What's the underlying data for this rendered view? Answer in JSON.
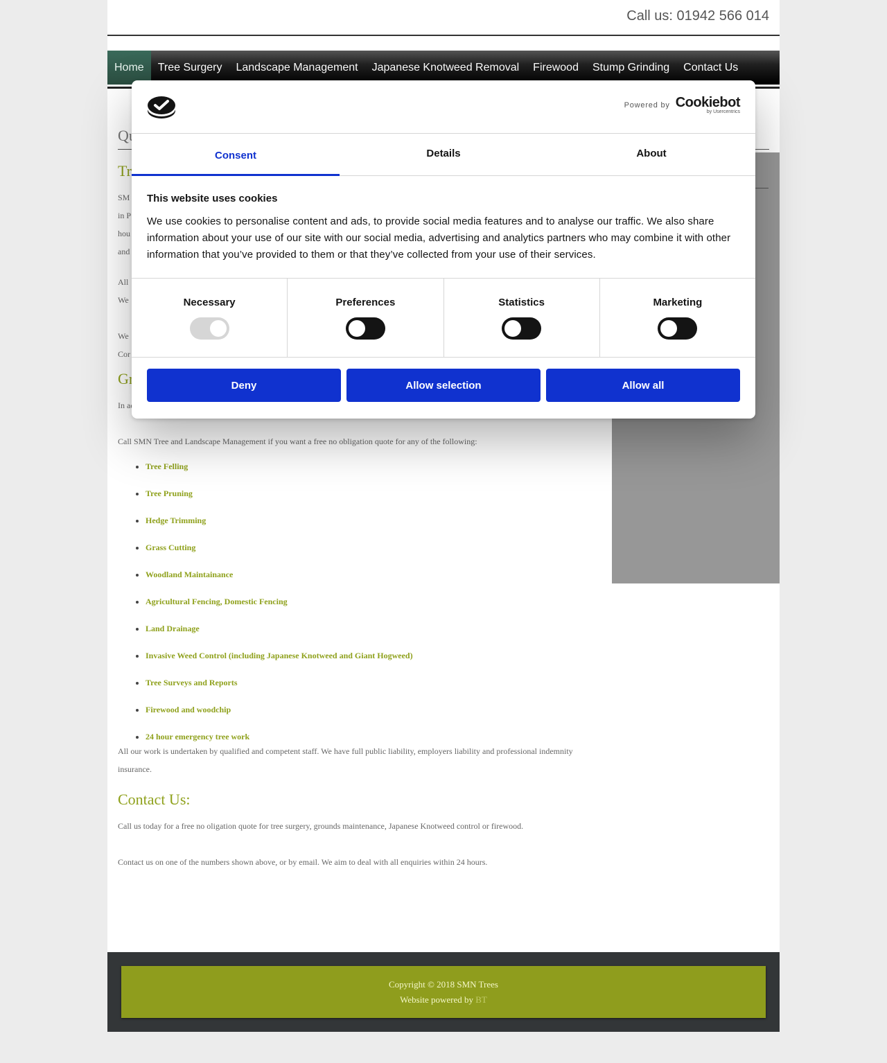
{
  "header": {
    "call_us": "Call us: 01942 566 014"
  },
  "nav": {
    "items": [
      {
        "label": "Home",
        "active": true
      },
      {
        "label": "Tree Surgery"
      },
      {
        "label": "Landscape Management"
      },
      {
        "label": "Japanese Knotweed Removal"
      },
      {
        "label": "Firewood"
      },
      {
        "label": "Stump Grinding"
      },
      {
        "label": "Contact Us"
      }
    ]
  },
  "content": {
    "page_heading_partial": "Qu",
    "section1_heading_partial": "Tr",
    "section1_lines_partial": [
      "SM",
      "in P",
      "hou",
      "and"
    ],
    "section1b_lines_partial": [
      "All",
      "We"
    ],
    "section1c_lines_partial": [
      "We",
      "Cor"
    ],
    "section2_heading_partial": "Gr",
    "para_grounds": "In addition to our arboricultural services we offer a range of bespoke grounds and landscape management services.",
    "para_call": "Call SMN Tree and Landscape Management if you want a free no obligation quote for any of the following:",
    "services": [
      "Tree Felling",
      "Tree Pruning",
      "Hedge Trimming",
      "Grass Cutting",
      "Woodland Maintainance",
      "Agricultural Fencing, Domestic Fencing",
      "Land Drainage",
      "Invasive Weed Control (including Japanese Knotweed and Giant Hogweed)",
      "Tree Surveys and Reports",
      "Firewood and woodchip",
      "24 hour emergency tree work"
    ],
    "para_staff": "All our work is undertaken by qualified and competent staff. We have full public liability, employers liability and professional indemnity insurance.",
    "contact_heading": "Contact Us:",
    "para_contact1": "Call us today for a free no oligation quote for tree surgery, grounds maintenance, Japanese Knotweed control or firewood.",
    "para_contact2": "Contact us on one of the numbers shown above, or by email. We aim to deal with all enquiries within 24 hours."
  },
  "footer": {
    "copyright": "Copyright © 2018 SMN Trees",
    "powered_prefix": "Website powered by",
    "powered_name": "BT"
  },
  "cookie_dialog": {
    "logo_icon": "cookiebot-check-logo-icon",
    "powered_by": "Powered by",
    "brand_name": "Cookiebot",
    "brand_sub": "by Usercentrics",
    "tabs": [
      {
        "label": "Consent",
        "active": true
      },
      {
        "label": "Details"
      },
      {
        "label": "About"
      }
    ],
    "title": "This website uses cookies",
    "text": "We use cookies to personalise content and ads, to provide social media features and to analyse our traffic. We also share information about your use of our site with our social media, advertising and analytics partners who may combine it with other information that you’ve provided to them or that they’ve collected from your use of their services.",
    "categories": [
      {
        "label": "Necessary",
        "checked": true,
        "disabled": true
      },
      {
        "label": "Preferences",
        "checked": false
      },
      {
        "label": "Statistics",
        "checked": false
      },
      {
        "label": "Marketing",
        "checked": false
      }
    ],
    "buttons": {
      "deny": "Deny",
      "allow_selection": "Allow selection",
      "allow_all": "Allow all"
    },
    "accent_color": "#1032cf"
  },
  "colors": {
    "brand_green": "#8fa11c",
    "nav_active": "#2b4d40",
    "footer_bg": "#333638"
  }
}
